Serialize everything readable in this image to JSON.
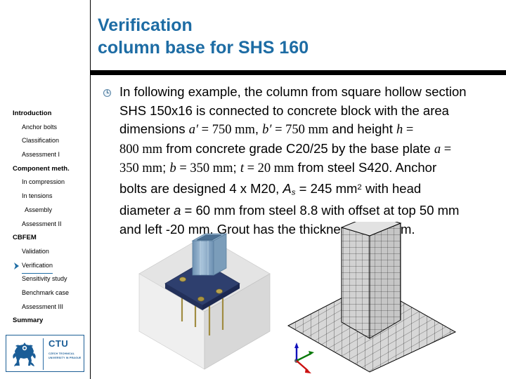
{
  "slide": {
    "title_lines": [
      "Verification",
      "column base for SHS 160"
    ],
    "title_color": "#1d6ca4",
    "rule_color": "#000000"
  },
  "sidebar": {
    "items": [
      {
        "label": "Introduction",
        "level": 0,
        "current": false
      },
      {
        "label": "Anchor bolts",
        "level": 1,
        "current": false
      },
      {
        "label": "Classification",
        "level": 1,
        "current": false
      },
      {
        "label": "Assessment I",
        "level": 1,
        "current": false
      },
      {
        "label": "Component meth.",
        "level": 0,
        "current": false
      },
      {
        "label": "In compression",
        "level": 1,
        "current": false
      },
      {
        "label": "In tensions",
        "level": 1,
        "current": false
      },
      {
        "label": "Assembly",
        "level": 2,
        "current": false
      },
      {
        "label": "Assessment II",
        "level": 1,
        "current": false
      },
      {
        "label": "CBFEM",
        "level": 0,
        "current": false
      },
      {
        "label": "Validation",
        "level": 1,
        "current": false
      },
      {
        "label": "Verification",
        "level": 1,
        "current": true
      },
      {
        "label": "Sensitivity study",
        "level": 1,
        "current": false
      },
      {
        "label": "Benchmark case",
        "level": 1,
        "current": false
      },
      {
        "label": "Assessment III",
        "level": 1,
        "current": false
      },
      {
        "label": "Summary",
        "level": 0,
        "current": false
      }
    ],
    "marker_icon": "chevron-right-icon",
    "accent_color": "#1d6ca4"
  },
  "logo": {
    "acronym": "CTU",
    "subtitle": "CZECH TECHNICAL UNIVERSITY IN PRAGUE",
    "emblem": "ctu-lion-emblem",
    "color": "#1a5d97"
  },
  "content": {
    "bullet_icon": "circle-arrow-bullet-icon",
    "paragraph": "In following example, the column from square hollow section SHS 150x16 is connected to concrete block with the area dimensions a' = 750 mm, b' = 750 mm and height h = 800 mm from concrete grade C20/25 by the base plate a = 350 mm; b = 350 mm; t = 20 mm from steel S420. Anchor bolts are designed 4 x M20, As = 245 mm2 with head diameter a = 60 mm from steel 8.8 with offset at top 50 mm and left -20 mm. Grout has the thickness of 30 mm.",
    "lines": [
      {
        "id": "l1",
        "parts": [
          {
            "t": "In following example, the column from square hollow section",
            "s": "plain"
          }
        ]
      },
      {
        "id": "l2",
        "parts": [
          {
            "t": "SHS 150x16 is connected to concrete block with the area",
            "s": "plain"
          }
        ]
      },
      {
        "id": "l3",
        "parts": [
          {
            "t": "dimensions ",
            "s": "plain"
          },
          {
            "t": "a′",
            "s": "math-italic"
          },
          {
            "t": " = ",
            "s": "math-roman"
          },
          {
            "t": "750 mm",
            "s": "math-roman"
          },
          {
            "t": ", ",
            "s": "plain"
          },
          {
            "t": "b′",
            "s": "math-italic"
          },
          {
            "t": " = ",
            "s": "math-roman"
          },
          {
            "t": "750 mm",
            "s": "math-roman"
          },
          {
            "t": " and height ",
            "s": "plain"
          },
          {
            "t": "h",
            "s": "math-italic"
          },
          {
            "t": " =",
            "s": "math-roman"
          }
        ]
      },
      {
        "id": "l4",
        "parts": [
          {
            "t": "800 mm",
            "s": "math-roman"
          },
          {
            "t": " from concrete grade C20/25 by the base plate ",
            "s": "plain"
          },
          {
            "t": "a",
            "s": "math-italic"
          },
          {
            "t": " =",
            "s": "math-roman"
          }
        ]
      },
      {
        "id": "l5",
        "parts": [
          {
            "t": "350 mm",
            "s": "math-roman"
          },
          {
            "t": "; ",
            "s": "plain"
          },
          {
            "t": "b",
            "s": "math-italic"
          },
          {
            "t": " = ",
            "s": "math-roman"
          },
          {
            "t": "350 mm",
            "s": "math-roman"
          },
          {
            "t": "; ",
            "s": "plain"
          },
          {
            "t": "t",
            "s": "math-italic"
          },
          {
            "t": " = ",
            "s": "math-roman"
          },
          {
            "t": "20 mm",
            "s": "math-roman"
          },
          {
            "t": " from steel S420. Anchor",
            "s": "plain"
          }
        ]
      },
      {
        "id": "l6",
        "parts": [
          {
            "t": "bolts are designed 4 x M20, ",
            "s": "plain"
          },
          {
            "t": "A",
            "s": "italic"
          },
          {
            "t": "s",
            "s": "sub-italic"
          },
          {
            "t": " = 245 mm",
            "s": "plain"
          },
          {
            "t": "2",
            "s": "sup"
          },
          {
            "t": " with head",
            "s": "plain"
          }
        ]
      },
      {
        "id": "l7",
        "parts": [
          {
            "t": "diameter ",
            "s": "plain"
          },
          {
            "t": "a",
            "s": "italic"
          },
          {
            "t": " = 60 mm from steel 8.8 with offset at top 50 mm",
            "s": "plain"
          }
        ]
      },
      {
        "id": "l8",
        "parts": [
          {
            "t": "and left -20 mm. Grout has the thickness of 30 mm.",
            "s": "plain"
          }
        ]
      }
    ]
  },
  "figures": [
    {
      "name": "cad-model-column-base",
      "caption": "",
      "parts": [
        "concrete-block",
        "base-plate",
        "shs-column",
        "anchor-bolts"
      ],
      "colors": {
        "concrete": "#d9d9d9",
        "plate": "#2e3f6e",
        "column": "#8fb0cc",
        "bolt": "#b09a4c"
      }
    },
    {
      "name": "fem-mesh-model",
      "caption": "",
      "parts": [
        "mesh-plate",
        "mesh-column",
        "contact-edge"
      ],
      "colors": {
        "mesh": "#d0d0d0",
        "line": "#000000",
        "contact": "#b03030"
      }
    }
  ],
  "axis_triad": {
    "labels": [
      "x",
      "y",
      "z"
    ],
    "colors": {
      "x": "#cc0000",
      "y": "#007700",
      "z": "#0000cc"
    }
  }
}
